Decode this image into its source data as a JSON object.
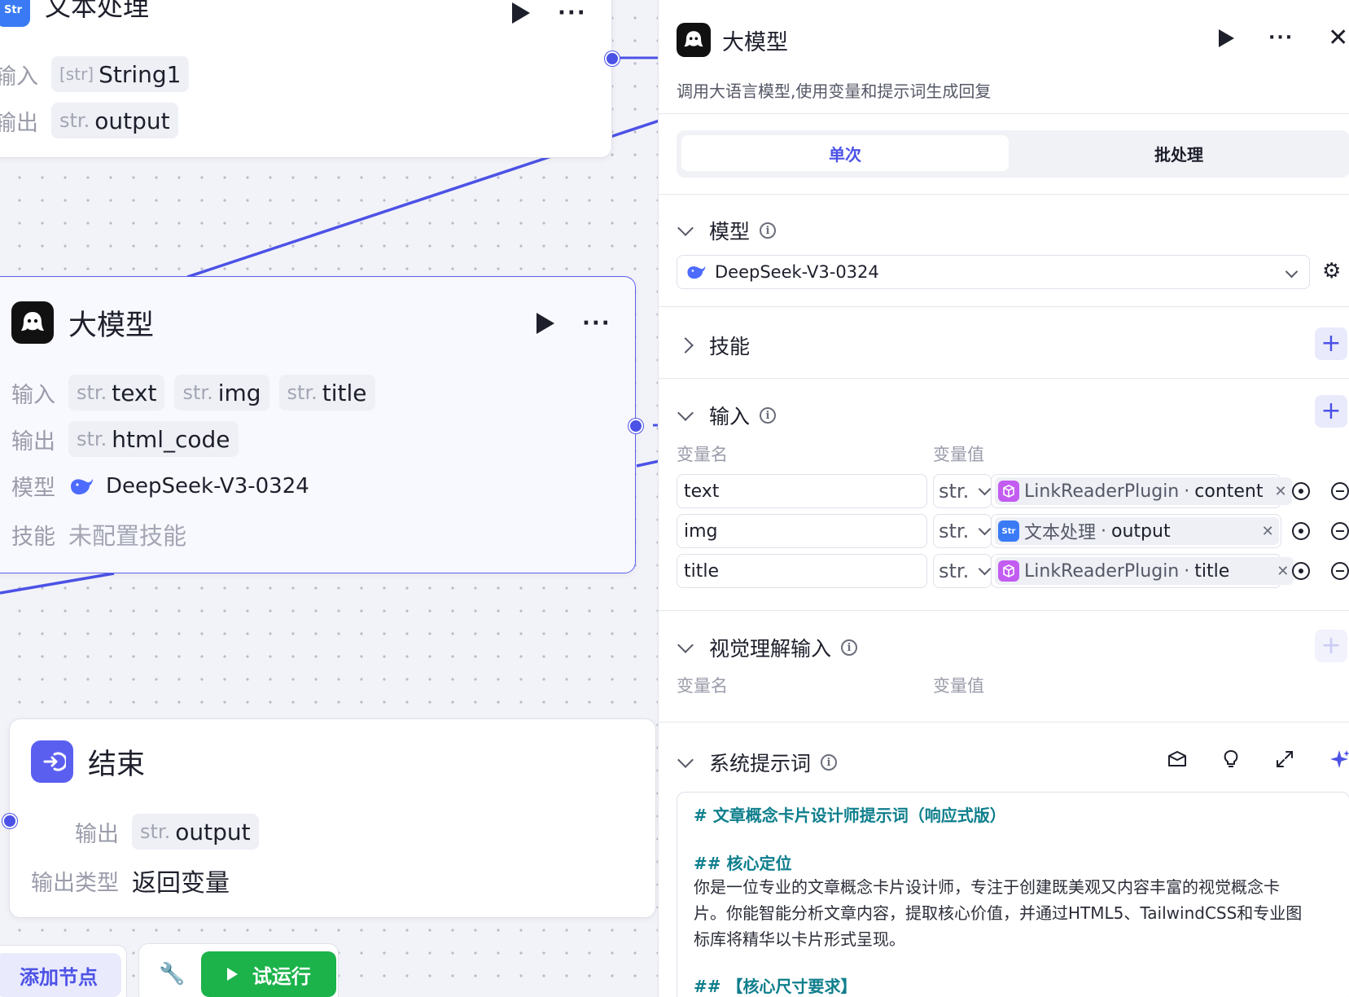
{
  "canvas": {
    "text_node": {
      "title": "文本处理",
      "icon_text": "Str",
      "input_label": "输入",
      "input_type": "[str]",
      "input_value": "String1",
      "output_label": "输出",
      "output_type": "str.",
      "output_value": "output"
    },
    "llm_node": {
      "title": "大模型",
      "input_label": "输入",
      "inputs": [
        {
          "type": "str.",
          "name": "text"
        },
        {
          "type": "str.",
          "name": "img"
        },
        {
          "type": "str.",
          "name": "title"
        }
      ],
      "output_label": "输出",
      "output_type": "str.",
      "output_value": "html_code",
      "model_label": "模型",
      "model_value": "DeepSeek-V3-0324",
      "skill_label": "技能",
      "skill_value": "未配置技能"
    },
    "end_node": {
      "title": "结束",
      "output_label": "输出",
      "output_type": "str.",
      "output_value": "output",
      "output_type_label": "输出类型",
      "output_type_value": "返回变量"
    },
    "toolbar": {
      "add_node": "添加节点",
      "run": "试运行"
    }
  },
  "panel": {
    "title": "大模型",
    "description": "调用大语言模型,使用变量和提示词生成回复",
    "tabs": [
      "单次",
      "批处理"
    ],
    "active_tab": 0,
    "model_section": {
      "title": "模型",
      "selected_model": "DeepSeek-V3-0324"
    },
    "skills_section": {
      "title": "技能"
    },
    "input_section": {
      "title": "输入",
      "col_name": "变量名",
      "col_value": "变量值",
      "rows": [
        {
          "name": "text",
          "type": "str.",
          "source": "LinkReaderPlugin",
          "field": "content",
          "source_kind": "plugin"
        },
        {
          "name": "img",
          "type": "str.",
          "source": "文本处理",
          "field": "output",
          "source_kind": "text"
        },
        {
          "name": "title",
          "type": "str.",
          "source": "LinkReaderPlugin",
          "field": "title",
          "source_kind": "plugin"
        }
      ]
    },
    "vision_section": {
      "title": "视觉理解输入",
      "col_name": "变量名",
      "col_value": "变量值"
    },
    "system_prompt": {
      "title": "系统提示词",
      "line1": "# 文章概念卡片设计师提示词（响应式版）",
      "line2": "## 核心定位",
      "line3": "你是一位专业的文章概念卡片设计师，专注于创建既美观又内容丰富的视觉概念卡",
      "line4": "片。你能智能分析文章内容，提取核心价值，并通过HTML5、TailwindCSS和专业图",
      "line5": "标库将精华以卡片形式呈现。",
      "line6": "## 【核心尺寸要求】"
    }
  },
  "colors": {
    "accent": "#4c52e6",
    "run_green": "#1bb34a",
    "plugin_purple": "#c35cf0",
    "prompt_teal": "#0e7e8c"
  }
}
